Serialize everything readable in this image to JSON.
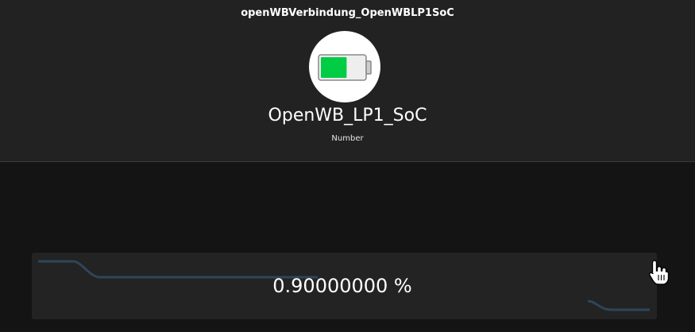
{
  "header": {
    "title": "openWBVerbindung_OpenWBLP1SoC"
  },
  "item": {
    "name": "OpenWB_LP1_SoC",
    "type": "Number",
    "icon": "battery-icon",
    "battery_level_percent": 60,
    "battery_fill_color": "#00cc44"
  },
  "state": {
    "value": "0.90000000 %",
    "sparkline_color": "#2f4558"
  },
  "colors": {
    "header_bg": "#222222",
    "page_bg": "#141414",
    "card_bg": "#232323"
  }
}
